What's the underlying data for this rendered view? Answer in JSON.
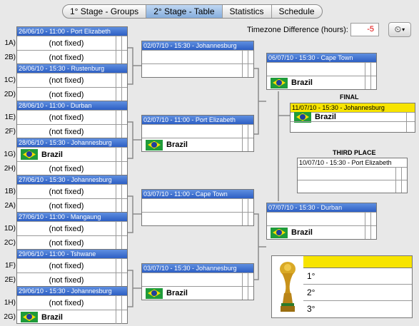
{
  "tabs": [
    {
      "label": "1° Stage - Groups"
    },
    {
      "label": "2° Stage - Table"
    },
    {
      "label": "Statistics"
    },
    {
      "label": "Schedule"
    }
  ],
  "timezone": {
    "label": "Timezone Difference (hours):",
    "value": "-5"
  },
  "round16": [
    {
      "header": "26/06/10 - 11:00 - Port Elizabeth",
      "slots": [
        "1A)",
        "2B)"
      ],
      "teams": [
        "(not fixed)",
        "(not fixed)"
      ]
    },
    {
      "header": "26/06/10 - 15:30 - Rustenburg",
      "slots": [
        "1C)",
        "2D)"
      ],
      "teams": [
        "(not fixed)",
        "(not fixed)"
      ]
    },
    {
      "header": "28/06/10 - 11:00 - Durban",
      "slots": [
        "1E)",
        "2F)"
      ],
      "teams": [
        "(not fixed)",
        "(not fixed)"
      ]
    },
    {
      "header": "28/06/10 - 15:30 - Johannesburg",
      "slots": [
        "1G)",
        "2H)"
      ],
      "teams": [
        "Brazil",
        "(not fixed)"
      ]
    },
    {
      "header": "27/06/10 - 15:30 - Johannesburg",
      "slots": [
        "1B)",
        "2A)"
      ],
      "teams": [
        "(not fixed)",
        "(not fixed)"
      ]
    },
    {
      "header": "27/06/10 - 11:00 - Mangaung",
      "slots": [
        "1D)",
        "2C)"
      ],
      "teams": [
        "(not fixed)",
        "(not fixed)"
      ]
    },
    {
      "header": "29/06/10 - 11:00 - Tshwane",
      "slots": [
        "1F)",
        "2E)"
      ],
      "teams": [
        "(not fixed)",
        "(not fixed)"
      ]
    },
    {
      "header": "29/06/10 - 15:30 - Johannesburg",
      "slots": [
        "1H)",
        "2G)"
      ],
      "teams": [
        "(not fixed)",
        "Brazil"
      ]
    }
  ],
  "quarters": [
    {
      "header": "02/07/10 - 15:30 - Johannesburg",
      "teams": [
        "",
        ""
      ]
    },
    {
      "header": "02/07/10 - 11:00 - Port Elizabeth",
      "teams": [
        "",
        "Brazil"
      ]
    },
    {
      "header": "03/07/10 - 11:00 - Cape Town",
      "teams": [
        "",
        ""
      ]
    },
    {
      "header": "03/07/10 - 15:30 - Johannesburg",
      "teams": [
        "",
        "Brazil"
      ]
    }
  ],
  "semis": [
    {
      "header": "06/07/10 - 15:30 - Cape Town",
      "teams": [
        "",
        "Brazil"
      ]
    },
    {
      "header": "07/07/10 - 15:30 - Durban",
      "teams": [
        "",
        "Brazil"
      ]
    }
  ],
  "final": {
    "title": "FINAL",
    "header": "11/07/10 - 15:30 - Johannesburg",
    "teams": [
      "Brazil",
      ""
    ]
  },
  "third_place": {
    "title": "THIRD PLACE",
    "header": "10/07/10 - 15:30 - Port Elizabeth",
    "teams": [
      "",
      ""
    ]
  },
  "podium": {
    "places": [
      "1°",
      "2°",
      "3°"
    ]
  },
  "colors": {
    "header_blue": "#3b6fd4",
    "gold": "#f7e400",
    "flag_green": "#1f9b3a",
    "flag_yellow": "#f8de00",
    "flag_blue": "#1f3f9c",
    "tz_red": "#e00000"
  }
}
